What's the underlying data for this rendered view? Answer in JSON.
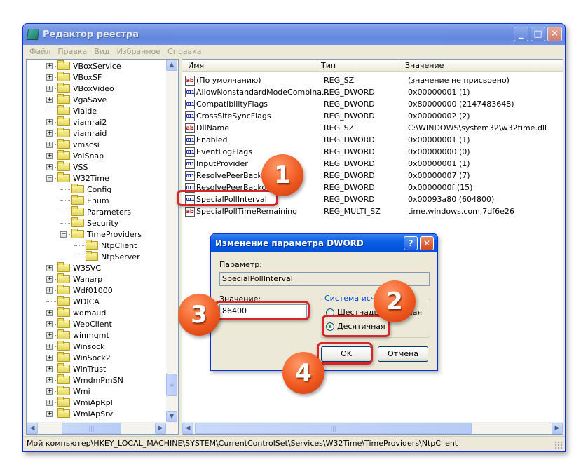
{
  "window": {
    "title": "Редактор реестра",
    "buttons": {
      "minimize": "_",
      "maximize": "□",
      "close": "✕"
    }
  },
  "menu": [
    "Файл",
    "Правка",
    "Вид",
    "Избранное",
    "Справка"
  ],
  "tree": [
    {
      "label": "VBoxService",
      "level": 0,
      "expander": "+"
    },
    {
      "label": "VBoxSF",
      "level": 0,
      "expander": "+"
    },
    {
      "label": "VBoxVideo",
      "level": 0,
      "expander": "+"
    },
    {
      "label": "VgaSave",
      "level": 0,
      "expander": "+"
    },
    {
      "label": "ViaIde",
      "level": 0,
      "expander": ""
    },
    {
      "label": "viamrai2",
      "level": 0,
      "expander": "+"
    },
    {
      "label": "viamraid",
      "level": 0,
      "expander": "+"
    },
    {
      "label": "vmscsi",
      "level": 0,
      "expander": "+"
    },
    {
      "label": "VolSnap",
      "level": 0,
      "expander": "+"
    },
    {
      "label": "VSS",
      "level": 0,
      "expander": "+"
    },
    {
      "label": "W32Time",
      "level": 0,
      "expander": "−"
    },
    {
      "label": "Config",
      "level": 1,
      "expander": ""
    },
    {
      "label": "Enum",
      "level": 1,
      "expander": ""
    },
    {
      "label": "Parameters",
      "level": 1,
      "expander": ""
    },
    {
      "label": "Security",
      "level": 1,
      "expander": ""
    },
    {
      "label": "TimeProviders",
      "level": 1,
      "expander": "−"
    },
    {
      "label": "NtpClient",
      "level": 2,
      "expander": "",
      "selected": true
    },
    {
      "label": "NtpServer",
      "level": 2,
      "expander": ""
    },
    {
      "label": "W3SVC",
      "level": 0,
      "expander": "+"
    },
    {
      "label": "Wanarp",
      "level": 0,
      "expander": "+"
    },
    {
      "label": "Wdf01000",
      "level": 0,
      "expander": "+"
    },
    {
      "label": "WDICA",
      "level": 0,
      "expander": ""
    },
    {
      "label": "wdmaud",
      "level": 0,
      "expander": "+"
    },
    {
      "label": "WebClient",
      "level": 0,
      "expander": "+"
    },
    {
      "label": "winmgmt",
      "level": 0,
      "expander": "+"
    },
    {
      "label": "Winsock",
      "level": 0,
      "expander": "+"
    },
    {
      "label": "WinSock2",
      "level": 0,
      "expander": "+"
    },
    {
      "label": "WinTrust",
      "level": 0,
      "expander": "+"
    },
    {
      "label": "WmdmPmSN",
      "level": 0,
      "expander": "+"
    },
    {
      "label": "Wmi",
      "level": 0,
      "expander": "+"
    },
    {
      "label": "WmiApRpl",
      "level": 0,
      "expander": "+"
    },
    {
      "label": "WmiApSrv",
      "level": 0,
      "expander": "+"
    }
  ],
  "list": {
    "columns": [
      "Имя",
      "Тип",
      "Значение"
    ],
    "rows": [
      {
        "icon": "sz",
        "name": "(По умолчанию)",
        "type": "REG_SZ",
        "value": "(значение не присвоено)"
      },
      {
        "icon": "dw",
        "name": "AllowNonstandardModeCombina...",
        "type": "REG_DWORD",
        "value": "0x00000001 (1)"
      },
      {
        "icon": "dw",
        "name": "CompatibilityFlags",
        "type": "REG_DWORD",
        "value": "0x80000000 (2147483648)"
      },
      {
        "icon": "dw",
        "name": "CrossSiteSyncFlags",
        "type": "REG_DWORD",
        "value": "0x00000002 (2)"
      },
      {
        "icon": "sz",
        "name": "DllName",
        "type": "REG_SZ",
        "value": "C:\\WINDOWS\\system32\\w32time.dll"
      },
      {
        "icon": "dw",
        "name": "Enabled",
        "type": "REG_DWORD",
        "value": "0x00000001 (1)"
      },
      {
        "icon": "dw",
        "name": "EventLogFlags",
        "type": "REG_DWORD",
        "value": "0x00000000 (0)"
      },
      {
        "icon": "dw",
        "name": "InputProvider",
        "type": "REG_DWORD",
        "value": "0x00000001 (1)"
      },
      {
        "icon": "dw",
        "name": "ResolvePeerBackoffM...",
        "type": "REG_DWORD",
        "value": "0x00000007 (7)"
      },
      {
        "icon": "dw",
        "name": "ResolvePeerBackoffM...",
        "type": "REG_DWORD",
        "value": "0x0000000f (15)"
      },
      {
        "icon": "dw",
        "name": "SpecialPollInterval",
        "type": "REG_DWORD",
        "value": "0x00093a80 (604800)"
      },
      {
        "icon": "sz",
        "name": "SpecialPollTimeRemaining",
        "type": "REG_MULTI_SZ",
        "value": "time.windows.com,7df6e26"
      }
    ]
  },
  "statusbar": "Мой компьютер\\HKEY_LOCAL_MACHINE\\SYSTEM\\CurrentControlSet\\Services\\W32Time\\TimeProviders\\NtpClient",
  "dialog": {
    "title": "Изменение параметра DWORD",
    "help": "?",
    "close": "✕",
    "param_label": "Параметр:",
    "param_value": "SpecialPollInterval",
    "value_label": "Значение:",
    "value": "86400",
    "base_group_label": "Система исчисления",
    "radio_hex": "Шестнадцатеричная",
    "radio_dec": "Десятичная",
    "selected_base": "decimal",
    "ok": "OK",
    "cancel": "Отмена"
  },
  "badges": [
    "1",
    "2",
    "3",
    "4"
  ]
}
